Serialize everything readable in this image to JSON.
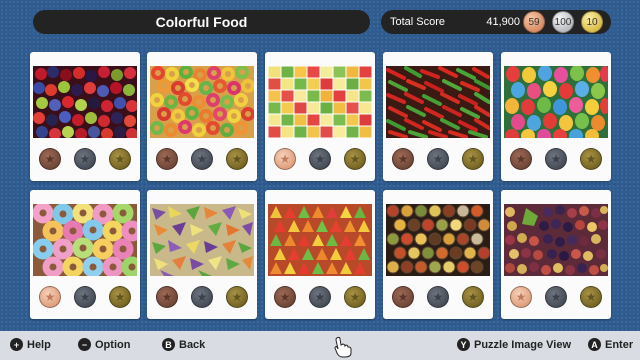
{
  "header": {
    "title": "Colorful Food",
    "score_label": "Total Score",
    "score_value": "41,900",
    "medal_counts": {
      "bronze": "59",
      "silver": "100",
      "gold": "10"
    }
  },
  "cards": [
    {
      "name": "berries",
      "bronze": "earned-none"
    },
    {
      "name": "cereal-rings",
      "bronze": "earned-none"
    },
    {
      "name": "fruit-cubes",
      "bronze": "earned"
    },
    {
      "name": "chili-peppers",
      "bronze": "earned-none"
    },
    {
      "name": "easter-eggs",
      "bronze": "earned-none"
    },
    {
      "name": "donuts",
      "bronze": "earned"
    },
    {
      "name": "pasta",
      "bronze": "earned-none"
    },
    {
      "name": "gummy-candy",
      "bronze": "earned-none"
    },
    {
      "name": "spices",
      "bronze": "earned-none"
    },
    {
      "name": "grapes",
      "bronze": "earned"
    }
  ],
  "footer": {
    "help_btn": "+",
    "help_label": "Help",
    "option_btn": "−",
    "option_label": "Option",
    "back_btn": "B",
    "back_label": "Back",
    "view_btn": "Y",
    "view_label": "Puzzle Image View",
    "enter_btn": "A",
    "enter_label": "Enter"
  },
  "icons": {
    "medal_star": "★"
  }
}
